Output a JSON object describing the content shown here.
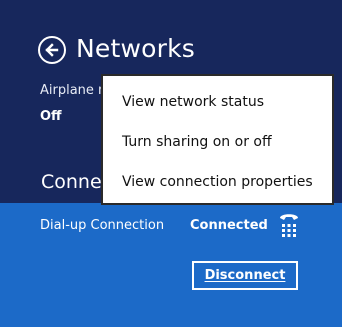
{
  "header": {
    "title": "Networks"
  },
  "airplane": {
    "label": "Airplane mode",
    "value": "Off"
  },
  "connections_section": {
    "title": "Connections"
  },
  "connection": {
    "name": "Dial-up Connection",
    "status": "Connected",
    "icon": "phone-icon",
    "disconnect_label": "Disconnect"
  },
  "context_menu": {
    "items": [
      {
        "label": "View network status"
      },
      {
        "label": "Turn sharing on or off"
      },
      {
        "label": "View connection properties"
      }
    ]
  },
  "colors": {
    "background": "#17275c",
    "selected_panel": "#1c6ac8",
    "menu_background": "#ffffff",
    "menu_border": "#2a2a2a"
  }
}
